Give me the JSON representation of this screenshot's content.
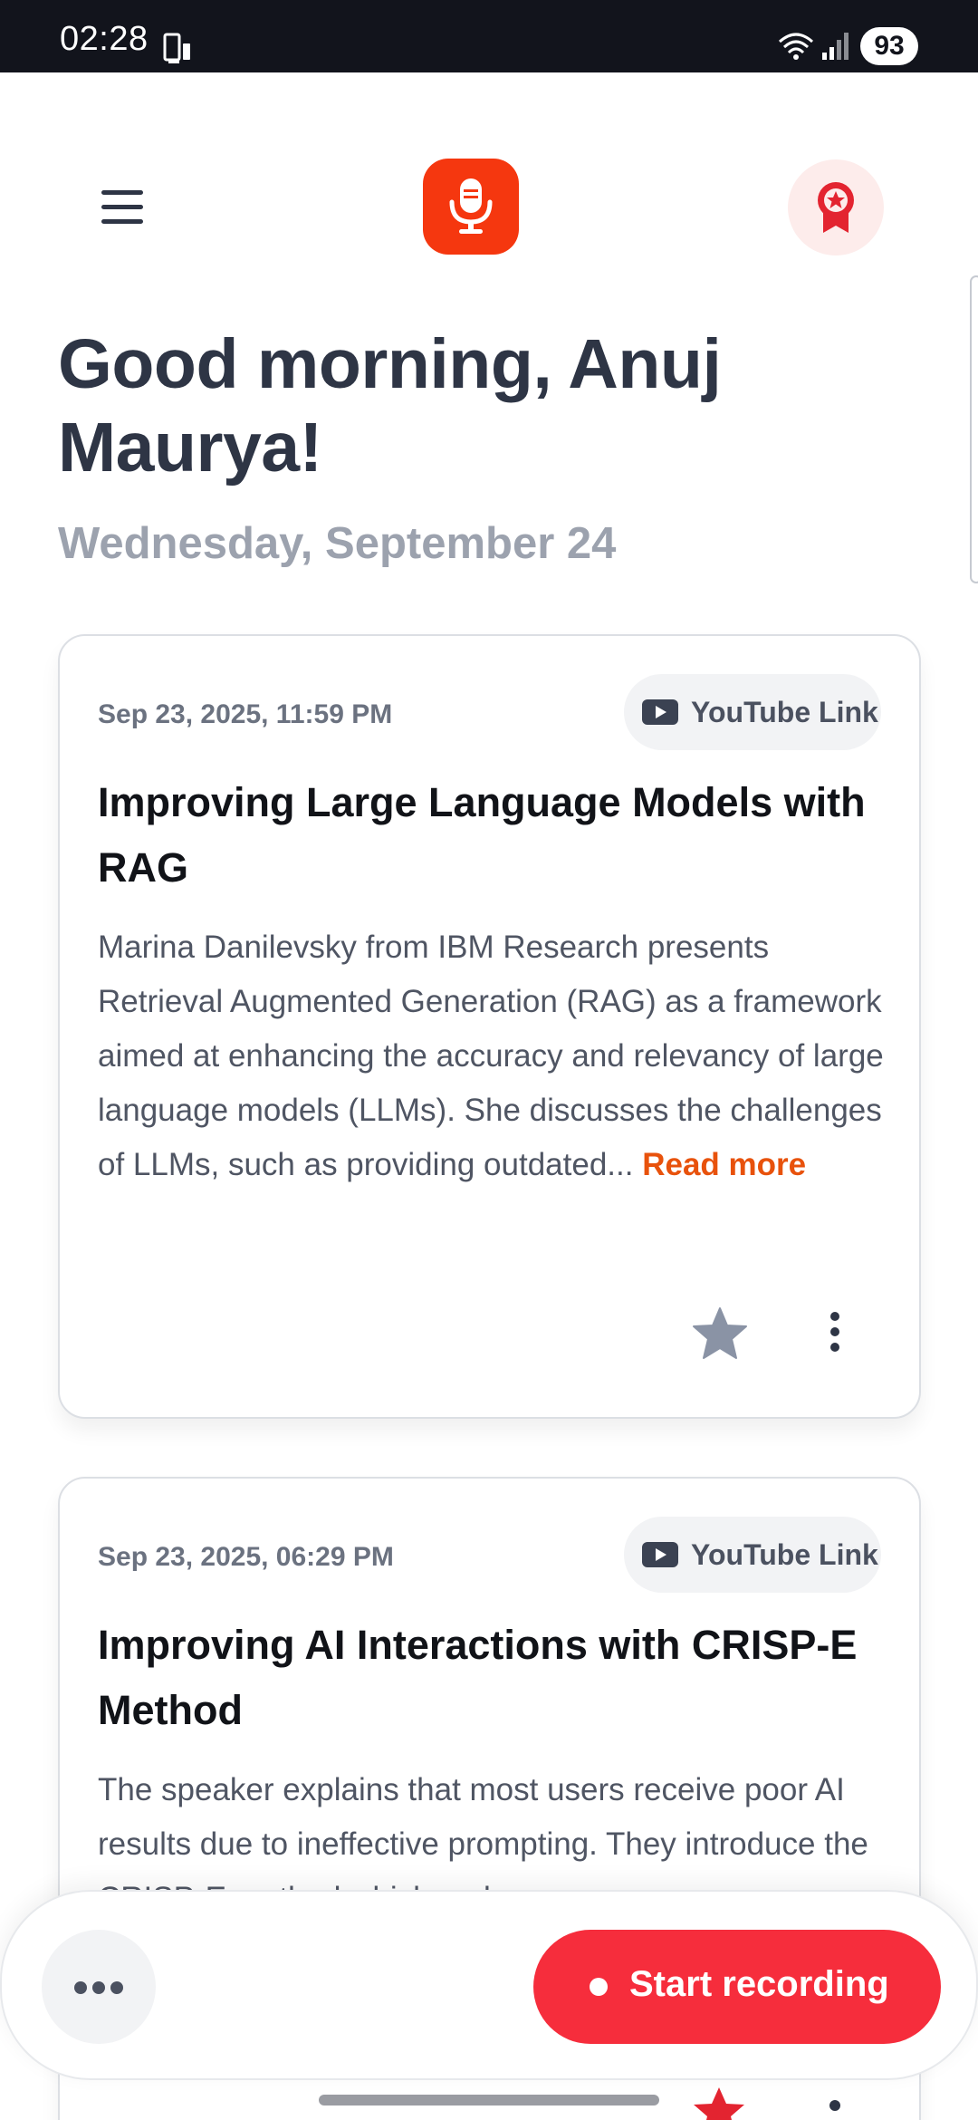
{
  "status_bar": {
    "time": "02:28",
    "battery": "93",
    "left_icon": "phone-sync-icon",
    "wifi_icon": "wifi-icon",
    "signal_icon": "signal-icon"
  },
  "header": {
    "menu_icon": "menu-icon",
    "logo_icon": "microphone-icon",
    "award_icon": "award-badge-icon",
    "logo_color": "#f5370f"
  },
  "greeting": "Good morning, Anuj Maurya!",
  "date": "Wednesday, September 24",
  "cards": [
    {
      "timestamp": "Sep 23, 2025, 11:59 PM",
      "source": "YouTube Link",
      "title": "Improving Large Language Models with RAG",
      "summary": "Marina Danilevsky from IBM Research presents Retrieval Augmented Generation (RAG) as a framework aimed at enhancing the accuracy and relevancy of large language models (LLMs). She discusses the challenges of LLMs, such as providing outdated...",
      "read_more": "Read more",
      "favorite": false
    },
    {
      "timestamp": "Sep 23, 2025, 06:29 PM",
      "source": "YouTube Link",
      "title": "Improving AI Interactions with CRISP-E Method",
      "summary": "The speaker explains that most users receive poor AI results due to ineffective prompting. They introduce the CRISP-E method which makes",
      "favorite": true
    }
  ],
  "bottom_bar": {
    "more_icon": "more-horizontal-icon",
    "record_label": "Start recording",
    "record_color": "#f62d3c"
  },
  "colors": {
    "accent": "#e8520c",
    "text_primary": "#2e3545",
    "text_muted": "#9ca2ae"
  }
}
